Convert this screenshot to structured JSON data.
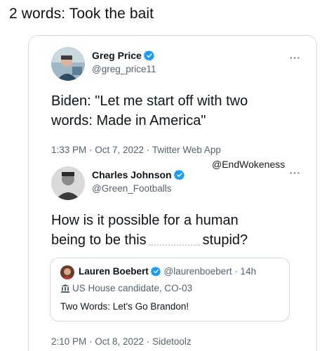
{
  "caption": "2 words: Took the bait",
  "tweet1": {
    "name": "Greg Price",
    "handle": "@greg_price11",
    "text_line1": "Biden: \"Let me start off with two",
    "text_line2": "words: Made in America\"",
    "meta": "1:33 PM · Oct 7, 2022 · Twitter Web App"
  },
  "watermark": "@EndWokeness",
  "tweet2": {
    "name": "Charles Johnson",
    "handle": "@Green_Footballs",
    "text_line1": "How is it possible for a human",
    "text_line2a": "being to be this",
    "text_line2b": "stupid?",
    "meta": "2:10 PM · Oct 8, 2022 · Sidetoolz"
  },
  "quote": {
    "name": "Lauren Boebert",
    "handle_time": "@laurenboebert · 14h",
    "label": "US House candidate, CO-03",
    "text": "Two Words: Let's Go Brandon!"
  },
  "more_label": "···",
  "colors": {
    "verified": "#1d9bf0",
    "secondary": "#536471",
    "border": "#d6d9dc"
  },
  "icons": [
    "verified-badge-icon",
    "more-options-icon",
    "government-building-icon"
  ]
}
